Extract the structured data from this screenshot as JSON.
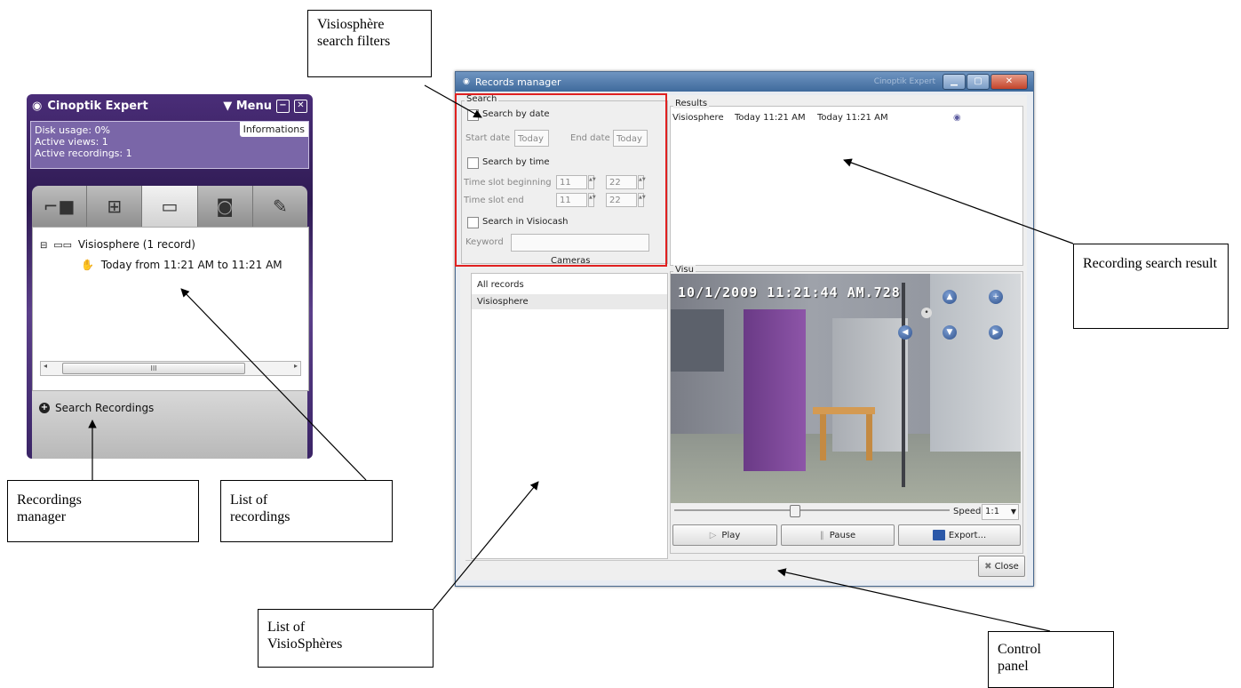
{
  "annotations": {
    "filters": "Visiosphère search filters",
    "search_result": "Recording search result",
    "recordings_manager": "Recordings manager",
    "list_of_recordings": "List of recordings",
    "list_of_visiospheres": "List of VisioSphères",
    "control_panel": "Control panel"
  },
  "cinoptik": {
    "title": "Cinoptik Expert",
    "menu_label": "▼ Menu",
    "info_tab": "Informations",
    "disk_usage": "Disk usage: 0%",
    "active_views": "Active views: 1",
    "active_recordings": "Active recordings: 1",
    "tree": {
      "group_label": "Visiosphere (1 record)",
      "item_label": "Today from 11:21 AM to 11:21 AM"
    },
    "scroll_mark": "III",
    "search_recordings": "Search Recordings"
  },
  "records_manager": {
    "title": "Records manager",
    "background_window": "Cinoptik Expert",
    "search": {
      "legend": "Search",
      "by_date": "Search by date",
      "start_date_label": "Start date",
      "start_date_value": "Today",
      "end_date_label": "End date",
      "end_date_value": "Today",
      "by_time": "Search by time",
      "slot_beginning_label": "Time slot beginning",
      "slot_beginning_h": "11",
      "slot_beginning_m": "22",
      "slot_end_label": "Time slot end",
      "slot_end_h": "11",
      "slot_end_m": "22",
      "in_visiocash": "Search in Visiocash",
      "keyword_label": "Keyword",
      "keyword_value": "",
      "cameras_label": "Cameras"
    },
    "cameras": [
      "All records",
      "Visiosphere"
    ],
    "results": {
      "legend": "Results",
      "rows": [
        {
          "camera": "Visiosphere",
          "start": "Today 11:21 AM",
          "end": "Today 11:21 AM"
        }
      ]
    },
    "visu": {
      "legend": "Visu",
      "timestamp": "10/1/2009 11:21:44 AM.728",
      "speed_label": "Speed:",
      "speed_value": "1:1"
    },
    "controls": {
      "play": "Play",
      "pause": "Pause",
      "export": "Export...",
      "close": "Close"
    }
  },
  "colors": {
    "highlight_frame": "#e02020",
    "cinoptik_purple": "#3a2466"
  }
}
